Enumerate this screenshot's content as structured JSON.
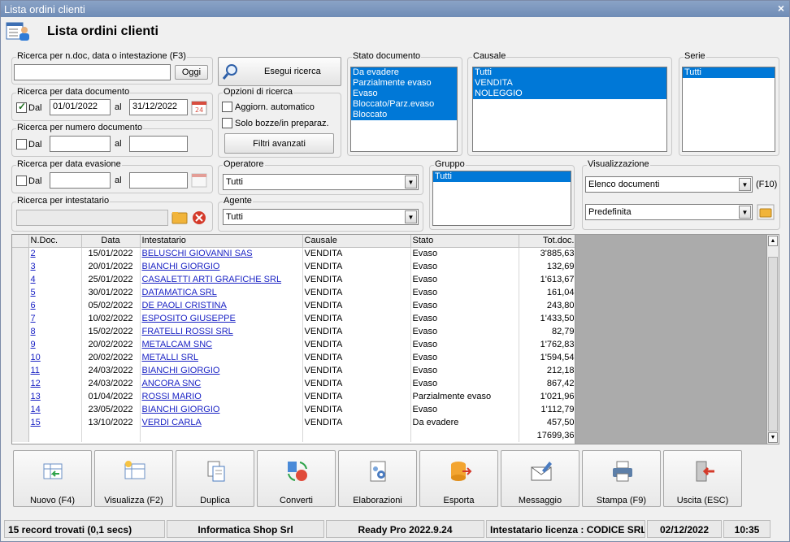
{
  "window": {
    "title": "Lista ordini clienti",
    "close": "×"
  },
  "header": {
    "title": "Lista ordini clienti"
  },
  "search_text": {
    "legend": "Ricerca per n.doc, data o intestazione (F3)",
    "value": "",
    "today_button": "Oggi"
  },
  "search_button": "Esegui ricerca",
  "search_date": {
    "legend": "Ricerca per data documento",
    "checked": true,
    "from_label": "Dal",
    "from": "01/01/2022",
    "to_label": "al",
    "to": "31/12/2022"
  },
  "search_number": {
    "legend": "Ricerca per numero documento",
    "from_label": "Dal",
    "from": "",
    "to_label": "al",
    "to": ""
  },
  "search_eva": {
    "legend": "Ricerca per data evasione",
    "from_label": "Dal",
    "from": "",
    "to_label": "al",
    "to": ""
  },
  "search_holder": {
    "legend": "Ricerca per intestatario",
    "value": ""
  },
  "options": {
    "legend": "Opzioni di ricerca",
    "auto_update": "Aggiorn. automatico",
    "drafts_only": "Solo bozze/in preparaz.",
    "advanced_button": "Filtri avanzati"
  },
  "stato": {
    "legend": "Stato documento",
    "items": [
      "Da evadere",
      "Parzialmente evaso",
      "Evaso",
      "Bloccato/Parz.evaso",
      "Bloccato"
    ]
  },
  "causale": {
    "legend": "Causale",
    "items": [
      "Tutti",
      "VENDITA",
      "NOLEGGIO"
    ]
  },
  "serie": {
    "legend": "Serie",
    "items": [
      "Tutti"
    ]
  },
  "operatore": {
    "legend": "Operatore",
    "value": "Tutti"
  },
  "agente": {
    "legend": "Agente",
    "value": "Tutti"
  },
  "gruppo": {
    "legend": "Gruppo",
    "items": [
      "Tutti"
    ]
  },
  "visual": {
    "legend": "Visualizzazione",
    "mode": "Elenco documenti",
    "mode_key": "(F10)",
    "layout": "Predefinita"
  },
  "grid": {
    "columns": [
      "N.Doc.",
      "Data",
      "Intestatario",
      "Causale",
      "Stato",
      "Tot.doc."
    ],
    "rows": [
      [
        "2",
        "15/01/2022",
        "BELUSCHI GIOVANNI SAS",
        "VENDITA",
        "Evaso",
        "3'885,63"
      ],
      [
        "3",
        "20/01/2022",
        "BIANCHI GIORGIO",
        "VENDITA",
        "Evaso",
        "132,69"
      ],
      [
        "4",
        "25/01/2022",
        "CASALETTI ARTI GRAFICHE SRL",
        "VENDITA",
        "Evaso",
        "1'613,67"
      ],
      [
        "5",
        "30/01/2022",
        "DATAMATICA SRL",
        "VENDITA",
        "Evaso",
        "161,04"
      ],
      [
        "6",
        "05/02/2022",
        "DE PAOLI CRISTINA",
        "VENDITA",
        "Evaso",
        "243,80"
      ],
      [
        "7",
        "10/02/2022",
        "ESPOSITO GIUSEPPE",
        "VENDITA",
        "Evaso",
        "1'433,50"
      ],
      [
        "8",
        "15/02/2022",
        "FRATELLI ROSSI SRL",
        "VENDITA",
        "Evaso",
        "82,79"
      ],
      [
        "9",
        "20/02/2022",
        "METALCAM SNC",
        "VENDITA",
        "Evaso",
        "1'762,83"
      ],
      [
        "10",
        "20/02/2022",
        "METALLI SRL",
        "VENDITA",
        "Evaso",
        "1'594,54"
      ],
      [
        "11",
        "24/03/2022",
        "BIANCHI GIORGIO",
        "VENDITA",
        "Evaso",
        "212,18"
      ],
      [
        "12",
        "24/03/2022",
        "ANCORA SNC",
        "VENDITA",
        "Evaso",
        "867,42"
      ],
      [
        "13",
        "01/04/2022",
        "ROSSI MARIO",
        "VENDITA",
        "Parzialmente evaso",
        "1'021,96"
      ],
      [
        "14",
        "23/05/2022",
        "BIANCHI GIORGIO",
        "VENDITA",
        "Evaso",
        "1'112,79"
      ],
      [
        "15",
        "13/10/2022",
        "VERDI CARLA",
        "VENDITA",
        "Da evadere",
        "457,50"
      ]
    ],
    "total": "17699,36"
  },
  "toolbar": [
    {
      "label": "Nuovo (F4)",
      "icon": "new-doc-icon"
    },
    {
      "label": "Visualizza (F2)",
      "icon": "view-icon"
    },
    {
      "label": "Duplica",
      "icon": "duplicate-icon"
    },
    {
      "label": "Converti",
      "icon": "convert-icon"
    },
    {
      "label": "Elaborazioni",
      "icon": "process-icon"
    },
    {
      "label": "Esporta",
      "icon": "export-icon"
    },
    {
      "label": "Messaggio",
      "icon": "message-icon"
    },
    {
      "label": "Stampa (F9)",
      "icon": "printer-icon"
    },
    {
      "label": "Uscita (ESC)",
      "icon": "exit-icon"
    }
  ],
  "status": {
    "records": "15 record trovati (0,1 secs)",
    "company": "Informatica Shop Srl",
    "version": "Ready Pro 2022.9.24",
    "license": "Intestatario licenza : CODICE SRL",
    "date": "02/12/2022",
    "time": "10:35"
  },
  "colors": {
    "selection": "#0078d7",
    "link": "#1a22c4",
    "titlebar": "#7a95bf"
  }
}
